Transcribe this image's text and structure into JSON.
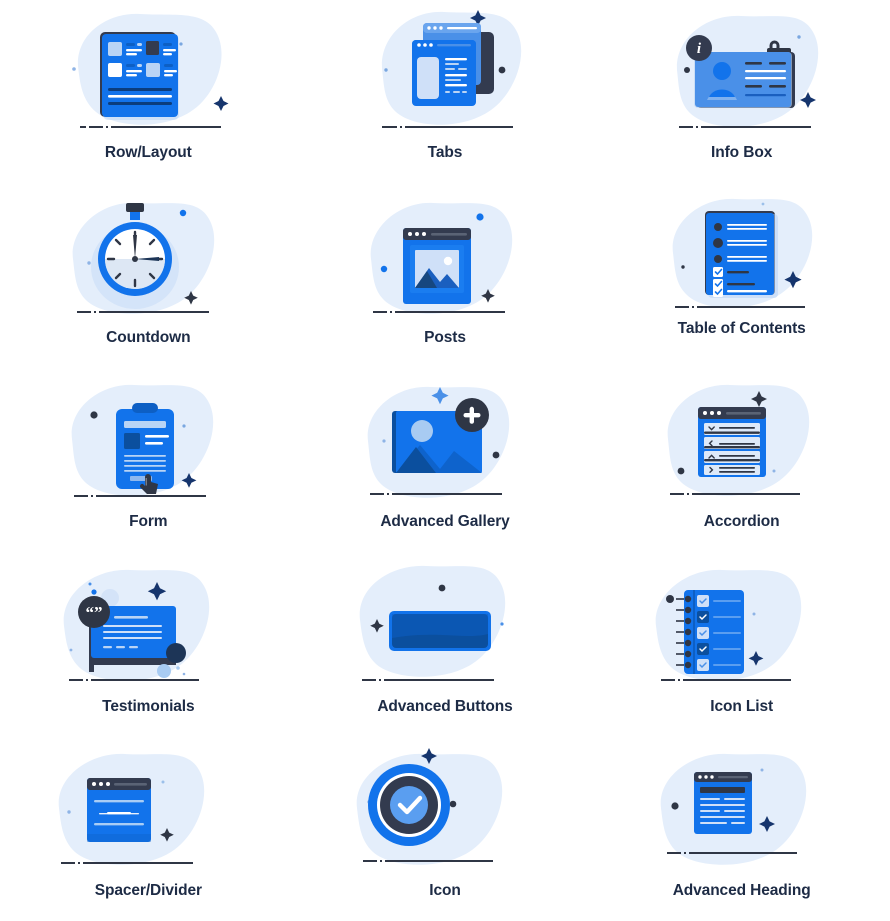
{
  "page": {
    "background": "#ffffff",
    "label_color": "#1d2b45",
    "palette": {
      "blue_primary": "#1273eb",
      "blue_dark": "#0d5fc4",
      "blue_deep": "#0b4f9e",
      "blue_mid": "#4a90e8",
      "blue_light": "#b9d4f5",
      "blue_pale": "#d9e6fa",
      "blob": "#e4eefb",
      "ink": "#333b4f",
      "ink_dark": "#2f3645",
      "navy_star": "#16356d",
      "white": "#ffffff"
    },
    "columns": 3,
    "rows": 5
  },
  "items": [
    {
      "label": "Row/Layout",
      "icon": "row-layout-icon"
    },
    {
      "label": "Tabs",
      "icon": "tabs-icon"
    },
    {
      "label": "Info Box",
      "icon": "info-box-icon"
    },
    {
      "label": "Countdown",
      "icon": "countdown-stopwatch-icon"
    },
    {
      "label": "Posts",
      "icon": "posts-window-image-icon"
    },
    {
      "label": "Table of Contents",
      "icon": "table-of-contents-icon"
    },
    {
      "label": "Form",
      "icon": "form-clipboard-icon"
    },
    {
      "label": "Advanced Gallery",
      "icon": "advanced-gallery-icon"
    },
    {
      "label": "Accordion",
      "icon": "accordion-icon"
    },
    {
      "label": "Testimonials",
      "icon": "testimonials-quote-bubble-icon"
    },
    {
      "label": "Advanced Buttons",
      "icon": "advanced-buttons-icon"
    },
    {
      "label": "Icon List",
      "icon": "icon-list-notebook-icon"
    },
    {
      "label": "Spacer/Divider",
      "icon": "spacer-divider-icon"
    },
    {
      "label": "Icon",
      "icon": "icon-check-circle-icon"
    },
    {
      "label": "Advanced Heading",
      "icon": "advanced-heading-icon"
    }
  ]
}
